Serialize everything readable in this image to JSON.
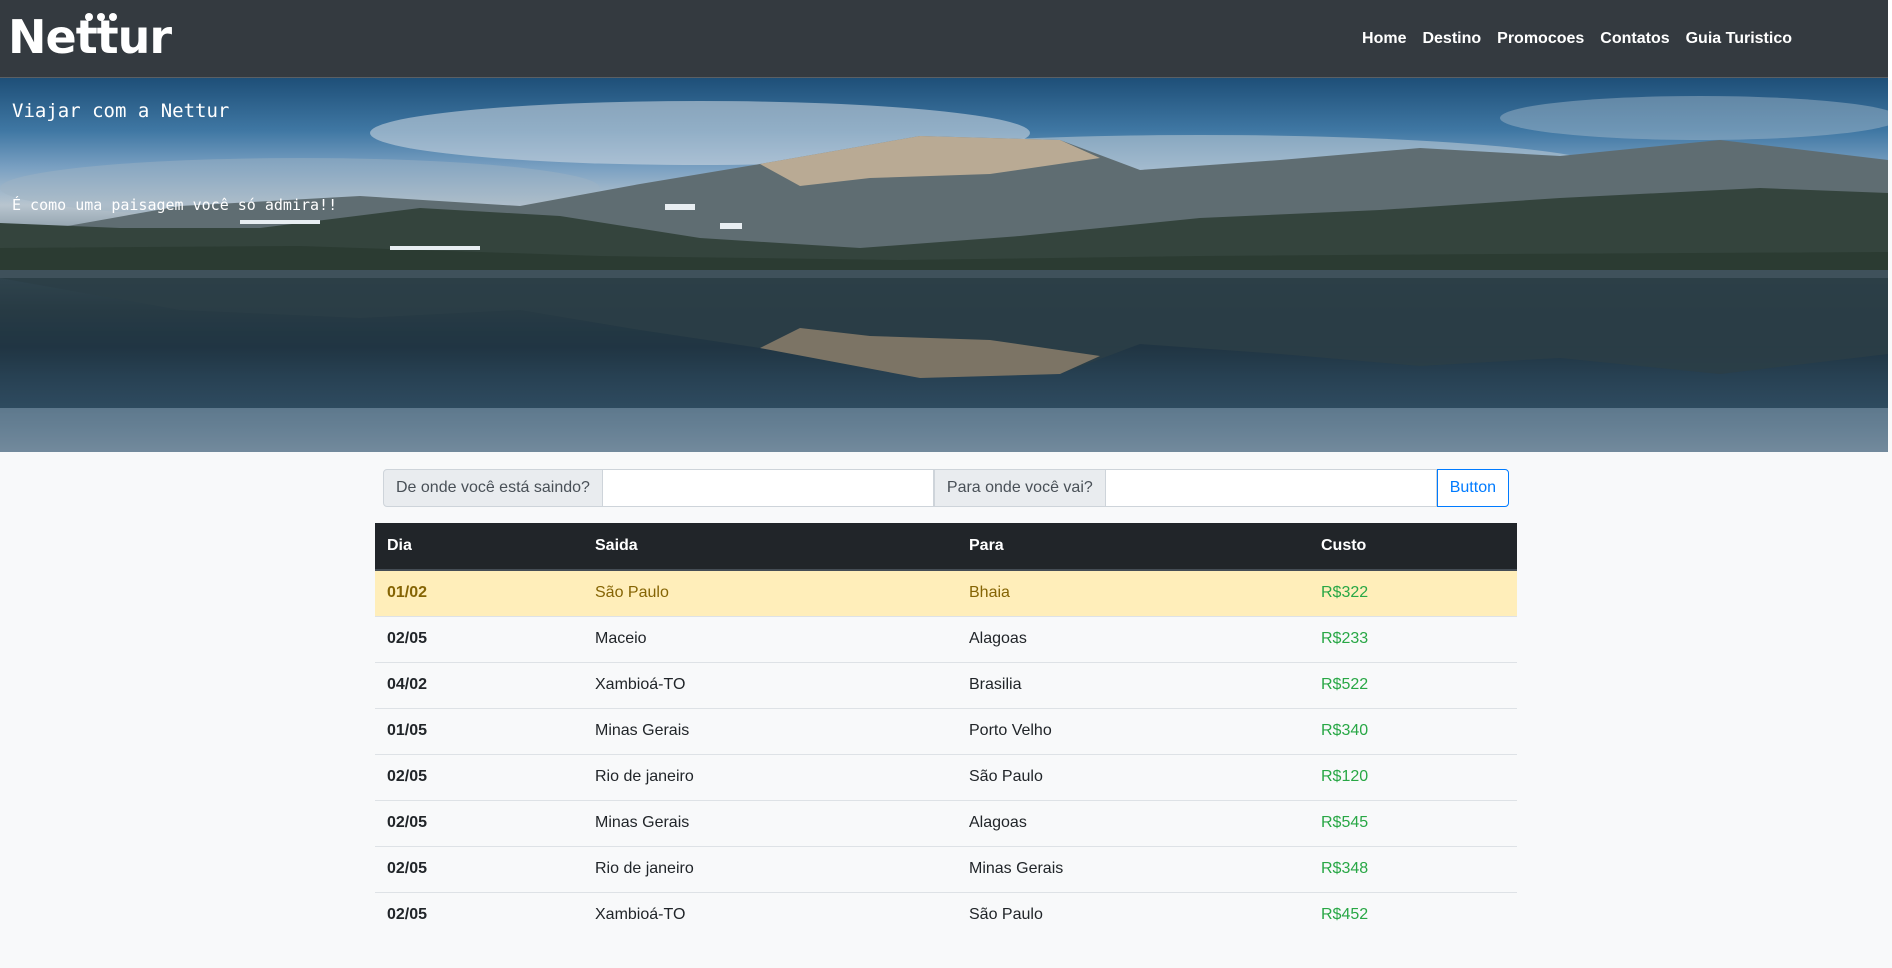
{
  "brand": {
    "logo_text": "Nettur"
  },
  "nav": {
    "items": [
      {
        "label": "Home"
      },
      {
        "label": "Destino"
      },
      {
        "label": "Promocoes"
      },
      {
        "label": "Contatos"
      },
      {
        "label": "Guia Turistico"
      }
    ]
  },
  "hero": {
    "title": "Viajar com a Nettur",
    "subtitle": "É como uma paisagem você só admira!!"
  },
  "search": {
    "from_label": "De onde você está saindo?",
    "from_value": "",
    "to_label": "Para onde você vai?",
    "to_value": "",
    "button_label": "Button"
  },
  "table": {
    "headers": [
      "Dia",
      "Saida",
      "Para",
      "Custo"
    ],
    "rows": [
      {
        "dia": "01/02",
        "saida": "São Paulo",
        "para": "Bhaia",
        "custo": "R$322",
        "highlight": true
      },
      {
        "dia": "02/05",
        "saida": "Maceio",
        "para": "Alagoas",
        "custo": "R$233"
      },
      {
        "dia": "04/02",
        "saida": "Xambioá-TO",
        "para": "Brasilia",
        "custo": "R$522"
      },
      {
        "dia": "01/05",
        "saida": "Minas Gerais",
        "para": "Porto Velho",
        "custo": "R$340"
      },
      {
        "dia": "02/05",
        "saida": "Rio de janeiro",
        "para": "São Paulo",
        "custo": "R$120"
      },
      {
        "dia": "02/05",
        "saida": "Minas Gerais",
        "para": "Alagoas",
        "custo": "R$545"
      },
      {
        "dia": "02/05",
        "saida": "Rio de janeiro",
        "para": "Minas Gerais",
        "custo": "R$348"
      },
      {
        "dia": "02/05",
        "saida": "Xambioá-TO",
        "para": "São Paulo",
        "custo": "R$452"
      }
    ]
  },
  "colors": {
    "navbar_bg": "#343a40",
    "table_head_bg": "#212529",
    "highlight_row_bg": "#ffeeba",
    "price_color": "#28a745",
    "button_color": "#007bff"
  }
}
